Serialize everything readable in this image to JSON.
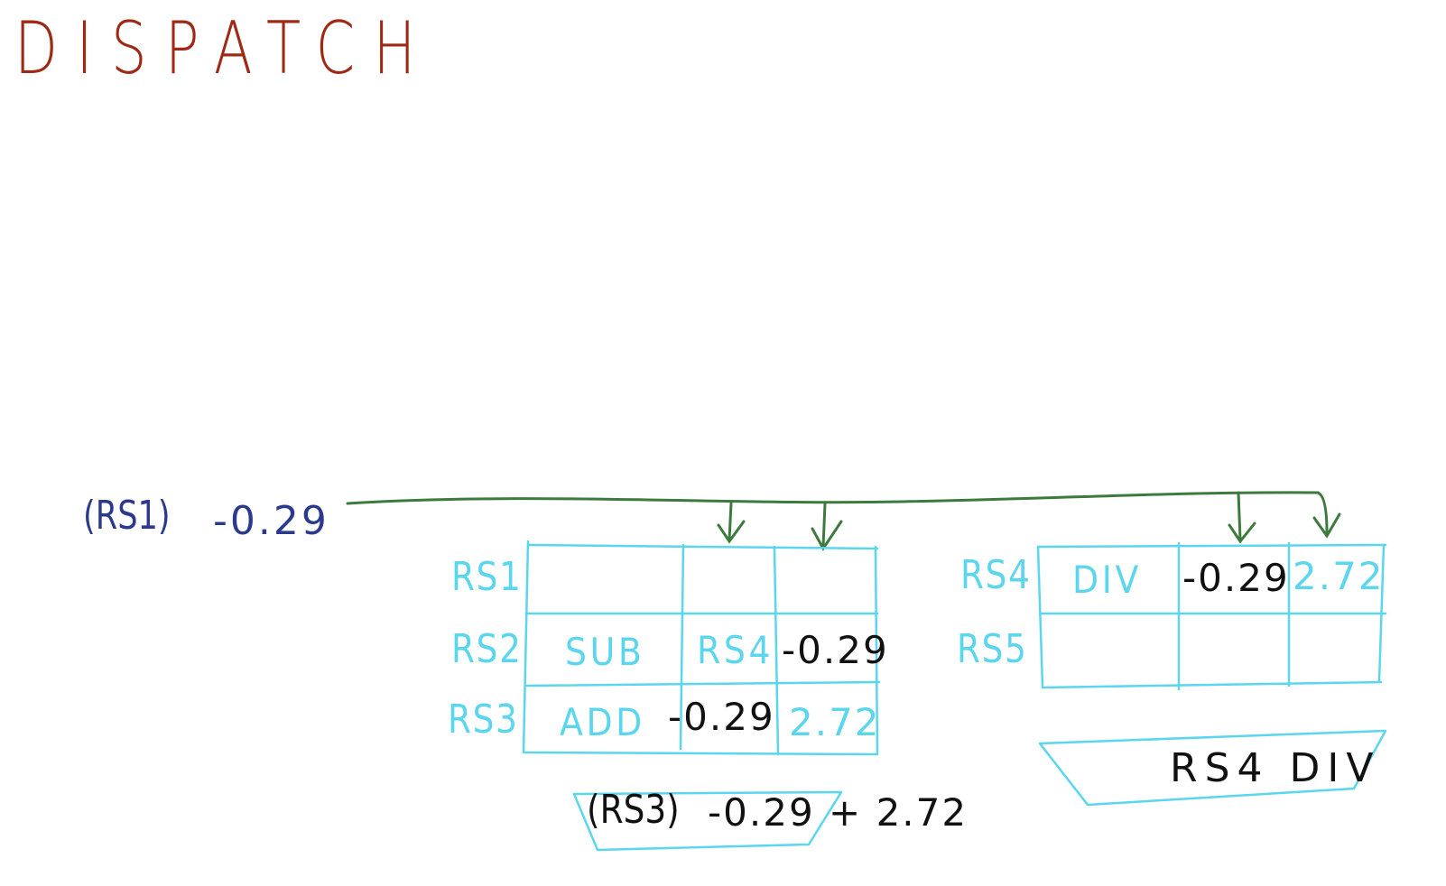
{
  "title": "DISPATCH",
  "broadcast": {
    "tag": "(RS1)",
    "value": "-0.29"
  },
  "rs_table_add": {
    "rows": [
      {
        "label": "RS1",
        "op": "",
        "src1": "",
        "src2": ""
      },
      {
        "label": "RS2",
        "op": "SUB",
        "src1": "RS4",
        "src2": "-0.29"
      },
      {
        "label": "RS3",
        "op": "ADD",
        "src1": "-0.29",
        "src2": "2.72"
      }
    ]
  },
  "rs_table_div": {
    "rows": [
      {
        "label": "RS4",
        "op": "DIV",
        "src1": "-0.29",
        "src2": "2.72"
      },
      {
        "label": "RS5",
        "op": "",
        "src1": "",
        "src2": ""
      }
    ]
  },
  "add_unit": {
    "tag": "(RS3)",
    "expression": "-0.29 + 2.72"
  },
  "div_unit": {
    "text": "RS4 DIV"
  },
  "colors": {
    "title": "#9e2a16",
    "table": "#5bd6ee",
    "arrow": "#3d7a3d",
    "broadcast": "#2b3a8c",
    "ink": "#111111"
  }
}
